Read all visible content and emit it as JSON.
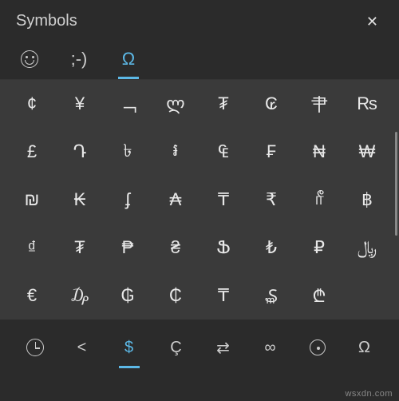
{
  "header": {
    "title": "Symbols",
    "close_glyph": "✕"
  },
  "tabs": [
    {
      "id": "emoji",
      "label": "emoji-face",
      "kind": "icon",
      "active": false
    },
    {
      "id": "kaomoji",
      "label": ";-)",
      "kind": "text",
      "active": false
    },
    {
      "id": "symbols",
      "label": "Ω",
      "kind": "text",
      "active": true
    }
  ],
  "grid": [
    [
      "¢",
      "¥",
      "﹁",
      "ლ",
      "₮",
      "₢",
      "肀",
      "₨"
    ],
    [
      "£",
      "Դ",
      "৳",
      "៛",
      "₠",
      "₣",
      "₦",
      "₩"
    ],
    [
      "₪",
      "₭",
      "ʄ",
      "₳",
      "₸",
      "₹",
      "ரீ",
      "฿"
    ],
    [
      "₫",
      "₮",
      "₱",
      "₴",
      "Ֆ",
      "₺",
      "₽",
      "﷼"
    ],
    [
      "€",
      "₯",
      "₲",
      "₵",
      "₸",
      "₷",
      "₾",
      " "
    ]
  ],
  "categories": [
    {
      "id": "recent",
      "glyph": "clock-icon",
      "active": false
    },
    {
      "id": "punctuation",
      "glyph": "<",
      "active": false
    },
    {
      "id": "currency",
      "glyph": "$",
      "active": true
    },
    {
      "id": "latin",
      "glyph": "Ç",
      "active": false
    },
    {
      "id": "arrows",
      "glyph": "⇄",
      "active": false
    },
    {
      "id": "math",
      "glyph": "∞",
      "active": false
    },
    {
      "id": "geometric",
      "glyph": "circled-dot",
      "active": false
    },
    {
      "id": "language",
      "glyph": "Ω",
      "active": false
    }
  ],
  "watermark": "wsxdn.com"
}
